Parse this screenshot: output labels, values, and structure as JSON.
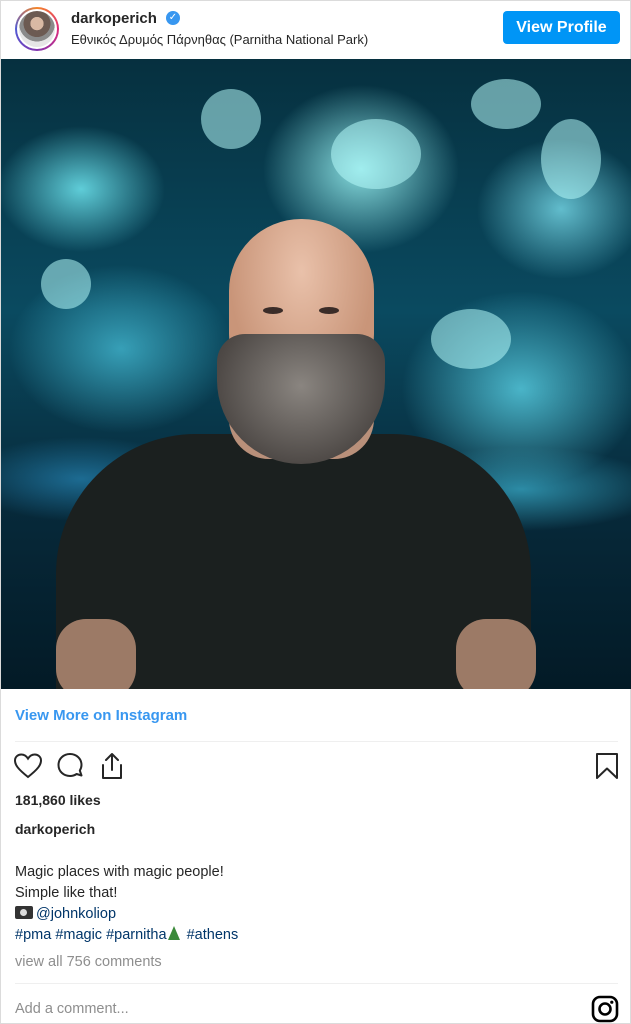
{
  "header": {
    "username": "darkoperich",
    "verified_mark": "✓",
    "location": "Εθνικός Δρυμός Πάρνηθας (Parnitha National Park)",
    "view_profile_label": "View Profile"
  },
  "view_more_label": "View More on Instagram",
  "likes_text": "181,860 likes",
  "caption": {
    "username": "darkoperich",
    "line1": "Magic places with magic people!",
    "line2": "Simple like that!",
    "mention": "@johnkoliop",
    "hashtags": [
      "#pma",
      "#magic",
      "#parnitha",
      "#athens"
    ]
  },
  "comments_link": "view all 756 comments",
  "comment_placeholder": "Add a comment...",
  "icons": {
    "like": "heart-icon",
    "comment": "comment-icon",
    "share": "share-icon",
    "save": "bookmark-icon",
    "instagram": "instagram-icon"
  },
  "colors": {
    "accent": "#0095f6",
    "link": "#3897f0",
    "hashtag": "#003569",
    "muted": "#8e8e8e"
  }
}
